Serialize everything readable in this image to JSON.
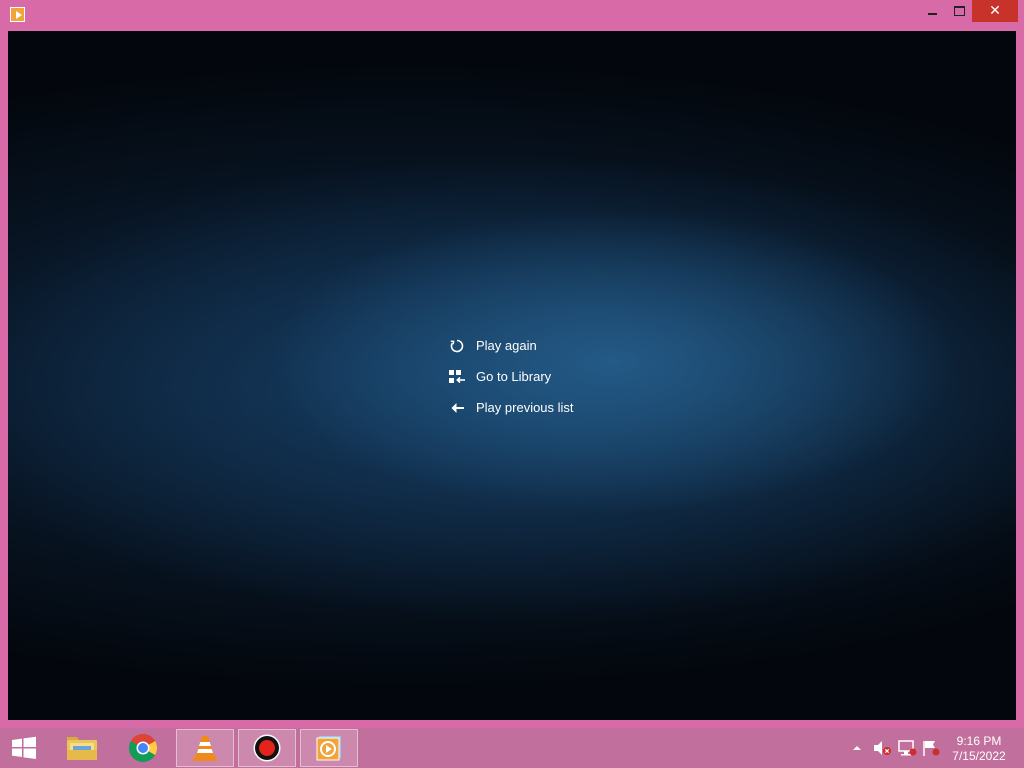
{
  "window": {
    "title": "",
    "icon": "media-player-icon",
    "controls": {
      "minimize": "minimize-icon",
      "maximize": "maximize-icon",
      "close": "close-icon"
    }
  },
  "player": {
    "menu": [
      {
        "label": "Play again",
        "icon": "replay-icon"
      },
      {
        "label": "Go to Library",
        "icon": "library-icon"
      },
      {
        "label": "Play previous list",
        "icon": "back-arrow-icon"
      }
    ]
  },
  "taskbar": {
    "apps": [
      {
        "name": "start-button",
        "icon": "windows-logo-icon"
      },
      {
        "name": "file-explorer",
        "icon": "folder-icon"
      },
      {
        "name": "chrome",
        "icon": "chrome-icon"
      },
      {
        "name": "vlc",
        "icon": "vlc-cone-icon"
      },
      {
        "name": "recorder",
        "icon": "record-icon"
      },
      {
        "name": "media-player",
        "icon": "media-player-icon"
      }
    ],
    "tray": {
      "icons": [
        "show-hidden-icons-chevron",
        "volume-muted-icon",
        "network-icon",
        "action-center-flag-icon"
      ],
      "time": "9:16 PM",
      "date": "7/15/2022"
    }
  },
  "colors": {
    "frame": "#d96aa8",
    "taskbar": "#c16f9c",
    "close_button": "#c7322b",
    "player_bg": "#03070d",
    "player_glow": "#26608e"
  }
}
